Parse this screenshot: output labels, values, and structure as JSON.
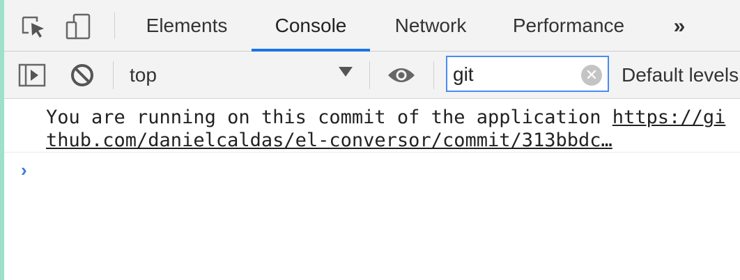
{
  "tabs": {
    "items": [
      {
        "label": "Elements",
        "active": false
      },
      {
        "label": "Console",
        "active": true
      },
      {
        "label": "Network",
        "active": false
      },
      {
        "label": "Performance",
        "active": false
      }
    ],
    "more_label": "»"
  },
  "toolbar": {
    "context": "top",
    "filter_value": "git",
    "levels_label": "Default levels"
  },
  "console": {
    "message_text": "You are running on this commit of the application ",
    "message_link": "https://github.com/danielcaldas/el-conversor/commit/313bbdc…",
    "prompt_symbol": "›"
  },
  "colors": {
    "accent": "#1a73e8",
    "filter_border": "#4a8af4",
    "prompt": "#3a7be0",
    "left_accent": "#9fe0c9"
  },
  "icons": [
    "inspect-element-icon",
    "device-toolbar-icon",
    "show-sidebar-icon",
    "clear-console-icon",
    "live-expression-eye-icon",
    "clear-filter-icon",
    "dropdown-arrow-icon"
  ]
}
